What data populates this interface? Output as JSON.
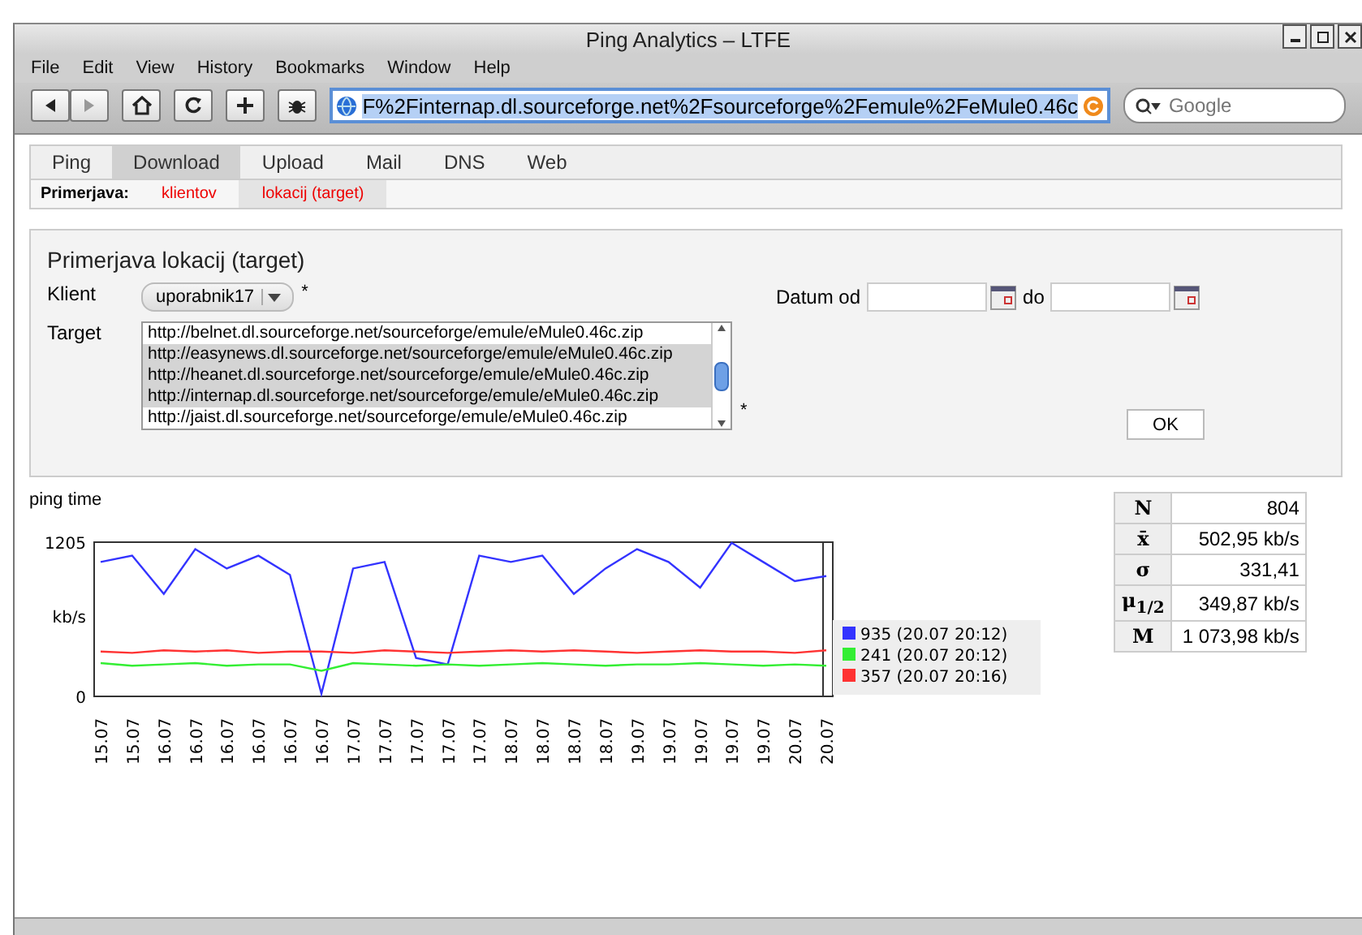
{
  "window": {
    "title": "Ping Analytics – LTFE"
  },
  "menu": [
    "File",
    "Edit",
    "View",
    "History",
    "Bookmarks",
    "Window",
    "Help"
  ],
  "address_bar": {
    "value": "F%2Finternap.dl.sourceforge.net%2Fsourceforge%2Femule%2FeMule0.46c"
  },
  "search": {
    "placeholder": "Google"
  },
  "tabs": [
    {
      "label": "Ping",
      "selected": false
    },
    {
      "label": "Download",
      "selected": true
    },
    {
      "label": "Upload",
      "selected": false
    },
    {
      "label": "Mail",
      "selected": false
    },
    {
      "label": "DNS",
      "selected": false
    },
    {
      "label": "Web",
      "selected": false
    }
  ],
  "subtabs": {
    "label": "Primerjava:",
    "items": [
      {
        "label": "klientov",
        "selected": false
      },
      {
        "label": "lokacij (target)",
        "selected": true
      }
    ]
  },
  "form": {
    "title": "Primerjava lokacij (target)",
    "client_label": "Klient",
    "client_value": "uporabnik17",
    "required_mark": "*",
    "target_label": "Target",
    "targets": [
      {
        "label": "http://belnet.dl.sourceforge.net/sourceforge/emule/eMule0.46c.zip",
        "selected": false
      },
      {
        "label": "http://easynews.dl.sourceforge.net/sourceforge/emule/eMule0.46c.zip",
        "selected": true
      },
      {
        "label": "http://heanet.dl.sourceforge.net/sourceforge/emule/eMule0.46c.zip",
        "selected": true
      },
      {
        "label": "http://internap.dl.sourceforge.net/sourceforge/emule/eMule0.46c.zip",
        "selected": true
      },
      {
        "label": "http://jaist.dl.sourceforge.net/sourceforge/emule/eMule0.46c.zip",
        "selected": false
      }
    ],
    "target_required_mark": "*",
    "date_from_label": "Datum od",
    "date_to_label": "do",
    "ok_button": "OK"
  },
  "chart": {
    "chart_data": {
      "type": "line",
      "title": "ping time",
      "ylabel": "kb/s",
      "ylim": [
        0,
        1205
      ],
      "legend": true,
      "yticks": [
        0,
        1205
      ],
      "categories": [
        "15.07",
        "15.07",
        "16.07",
        "16.07",
        "16.07",
        "16.07",
        "16.07",
        "16.07",
        "17.07",
        "17.07",
        "17.07",
        "17.07",
        "17.07",
        "18.07",
        "18.07",
        "18.07",
        "18.07",
        "19.07",
        "19.07",
        "19.07",
        "19.07",
        "19.07",
        "20.07",
        "20.07"
      ],
      "series": [
        {
          "name": "935 (20.07 20:12)",
          "color": "#3333ff",
          "values": [
            1050,
            1100,
            800,
            1150,
            1000,
            1100,
            950,
            20,
            1000,
            1050,
            300,
            250,
            1100,
            1050,
            1100,
            800,
            1000,
            1150,
            1050,
            850,
            1200,
            1050,
            900,
            940
          ]
        },
        {
          "name": "241 (20.07 20:12)",
          "color": "#33ee33",
          "values": [
            260,
            240,
            250,
            260,
            240,
            250,
            250,
            200,
            260,
            250,
            240,
            250,
            240,
            250,
            260,
            250,
            240,
            250,
            250,
            260,
            250,
            240,
            250,
            240
          ]
        },
        {
          "name": "357 (20.07 20:16)",
          "color": "#ff3333",
          "values": [
            350,
            340,
            360,
            350,
            360,
            340,
            350,
            350,
            340,
            360,
            350,
            340,
            350,
            360,
            350,
            360,
            350,
            340,
            350,
            360,
            350,
            350,
            340,
            360
          ]
        }
      ]
    }
  },
  "stats": [
    {
      "symbol": "N",
      "value": "804"
    },
    {
      "symbol": "x̄",
      "value": "502,95 kb/s"
    },
    {
      "symbol": "σ",
      "value": "331,41"
    },
    {
      "symbol": "μ$_{1/2}$",
      "value": "349,87 kb/s"
    },
    {
      "symbol": "M",
      "value": "1 073,98 kb/s"
    }
  ]
}
